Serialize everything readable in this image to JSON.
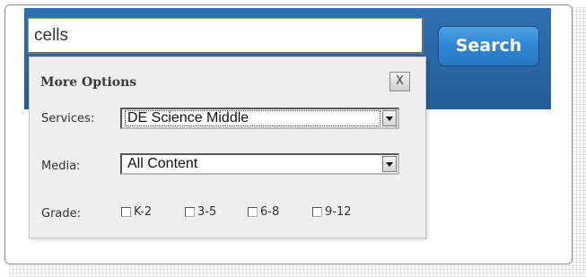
{
  "search": {
    "value": "cells",
    "button_label": "Search"
  },
  "options": {
    "title": "More Options",
    "close_label": "X",
    "services": {
      "label": "Services:",
      "selected": "DE Science Middle"
    },
    "media": {
      "label": "Media:",
      "selected": "All Content"
    },
    "grade": {
      "label": "Grade:",
      "levels": [
        "K-2",
        "3-5",
        "6-8",
        "9-12"
      ]
    }
  },
  "colors": {
    "header_blue": "#2a66a6",
    "button_blue": "#2f86d2",
    "panel_bg": "#efefef"
  }
}
